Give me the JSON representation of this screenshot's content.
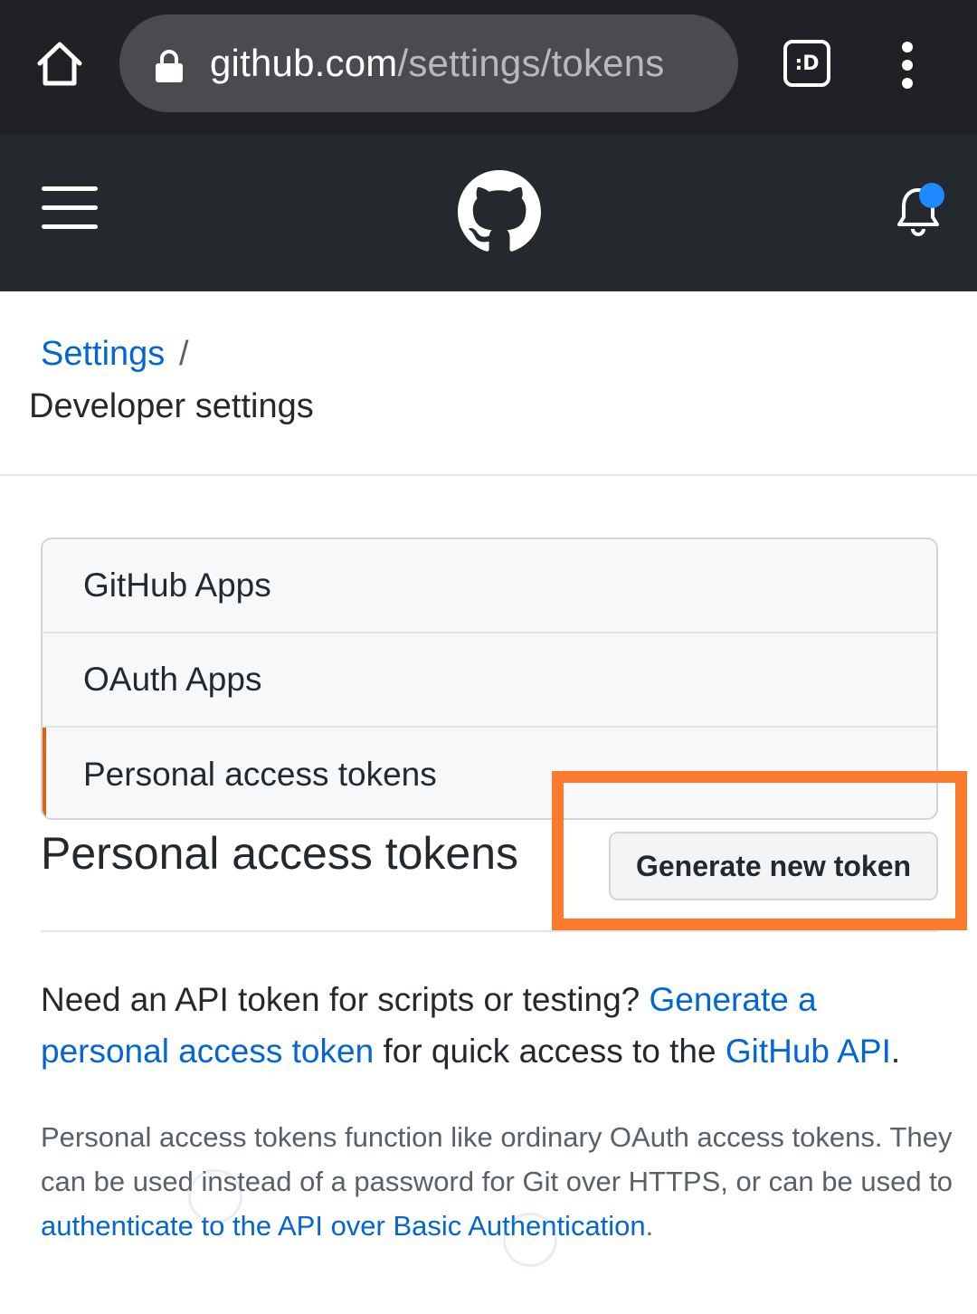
{
  "browser": {
    "url_host": "github.com",
    "url_path": "/settings/tokens",
    "tab_switcher_label": ":D",
    "icons": [
      "home-icon",
      "lock-icon",
      "tab-switcher-icon",
      "more-vert-icon"
    ]
  },
  "header": {
    "icons": [
      "hamburger-menu-icon",
      "github-octocat-logo",
      "bell-notification-icon"
    ],
    "notification_dot_color": "#1f8aff"
  },
  "breadcrumb": {
    "parent": "Settings",
    "separator": "/",
    "current": "Developer settings"
  },
  "menu": {
    "items": [
      {
        "label": "GitHub Apps"
      },
      {
        "label": "OAuth Apps"
      },
      {
        "label": "Personal access tokens",
        "selected": true
      }
    ],
    "selected_accent_color": "#e36209"
  },
  "section": {
    "title": "Personal access tokens",
    "generate_button": "Generate new token",
    "highlight_color": "#fb7a2c"
  },
  "intro": {
    "text_1": "Need an API token for scripts or testing? ",
    "link_1": "Generate a personal access token",
    "text_2": " for quick access to the ",
    "link_2": "GitHub API",
    "text_3": "."
  },
  "description": {
    "text_1": "Personal access tokens function like ordinary OAuth access tokens. They can be used instead of a password for Git over HTTPS, or can be used to ",
    "link_1": "authenticate to the API over Basic Authentication",
    "text_2": "."
  },
  "colors": {
    "link": "#0366d6",
    "browser_bar": "#202124",
    "github_header": "#24292e"
  }
}
